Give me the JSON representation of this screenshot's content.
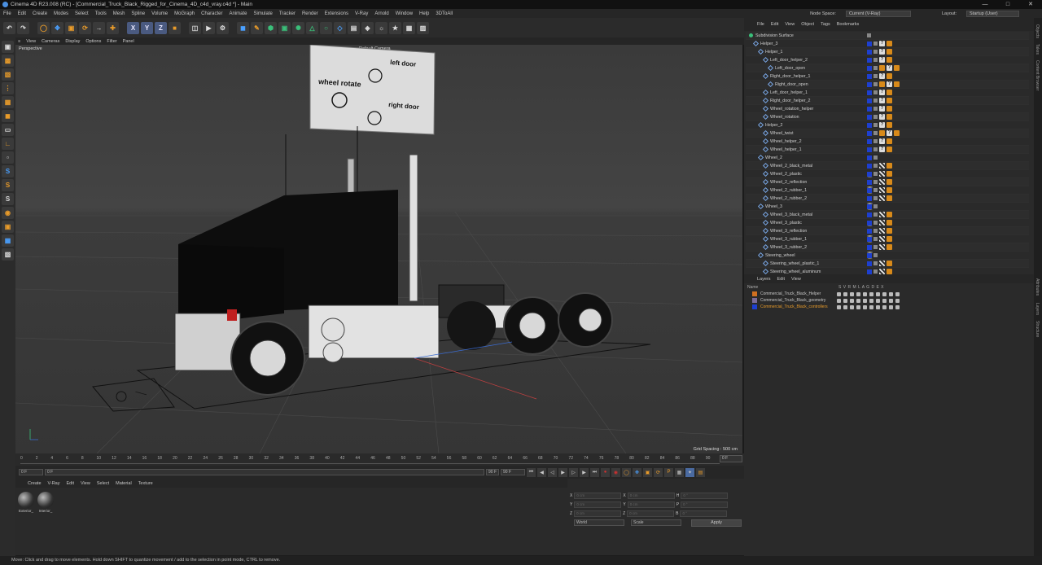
{
  "window": {
    "title": "Cinema 4D R23.008 (RC) - [Commercial_Truck_Black_Rigged_for_Cinema_4D_c4d_vray.c4d *] - Main"
  },
  "menu": [
    "File",
    "Edit",
    "Create",
    "Modes",
    "Select",
    "Tools",
    "Mesh",
    "Spline",
    "Volume",
    "MoGraph",
    "Character",
    "Animate",
    "Simulate",
    "Tracker",
    "Render",
    "Extensions",
    "V-Ray",
    "Arnold",
    "Window",
    "Help",
    "3DToAll"
  ],
  "node_space": {
    "label": "Node Space:",
    "value": "Current (V-Ray)"
  },
  "layout": {
    "label": "Layout:",
    "value": "Startup (User)"
  },
  "viewport_menu": [
    "View",
    "Cameras",
    "Display",
    "Options",
    "Filter",
    "Panel"
  ],
  "viewport": {
    "name": "Perspective",
    "camera": "Default Camera",
    "grid_spacing": "Grid Spacing : 500 cm",
    "sign_wheel_rotate": "wheel rotate",
    "sign_left_door": "left door",
    "sign_right_door": "right door"
  },
  "colors": {
    "accent": "#e89b2a",
    "blue": "#1d3fd0",
    "layer1": "#d07020",
    "layer2": "#7a6b9a",
    "layer3": "#1d3fd0"
  },
  "timeline": {
    "ticks": [
      "0",
      "2",
      "4",
      "6",
      "8",
      "10",
      "12",
      "14",
      "16",
      "18",
      "20",
      "22",
      "24",
      "26",
      "28",
      "30",
      "32",
      "34",
      "36",
      "38",
      "40",
      "42",
      "44",
      "46",
      "48",
      "50",
      "52",
      "54",
      "56",
      "58",
      "60",
      "62",
      "64",
      "66",
      "68",
      "70",
      "72",
      "74",
      "76",
      "78",
      "80",
      "82",
      "84",
      "86",
      "88",
      "90"
    ],
    "current_frame": "0 F"
  },
  "transport": {
    "start": "0 F",
    "min": "0 F",
    "max": "90 F",
    "end": "90 F"
  },
  "objects": {
    "menu": [
      "File",
      "Edit",
      "View",
      "Object",
      "Tags",
      "Bookmarks"
    ],
    "rows": [
      {
        "name": "Subdivision Surface",
        "indent": 0,
        "kind": "green",
        "tags": []
      },
      {
        "name": "Helper_3",
        "indent": 1,
        "kind": "null",
        "tags": [
          "q",
          "or"
        ]
      },
      {
        "name": "Helper_1",
        "indent": 2,
        "kind": "null",
        "tags": [
          "q",
          "or"
        ]
      },
      {
        "name": "Left_door_helper_2",
        "indent": 3,
        "kind": "null",
        "tags": [
          "q",
          "or"
        ]
      },
      {
        "name": "Left_door_open",
        "indent": 4,
        "kind": "null",
        "tags": [
          "or",
          "q",
          "or"
        ]
      },
      {
        "name": "Right_door_helper_1",
        "indent": 3,
        "kind": "null",
        "tags": [
          "q",
          "or"
        ]
      },
      {
        "name": "Right_door_open",
        "indent": 4,
        "kind": "null",
        "tags": [
          "or",
          "q",
          "or"
        ]
      },
      {
        "name": "Left_door_helper_1",
        "indent": 3,
        "kind": "null",
        "tags": [
          "q",
          "or"
        ]
      },
      {
        "name": "Right_door_helper_2",
        "indent": 3,
        "kind": "null",
        "tags": [
          "q",
          "or"
        ]
      },
      {
        "name": "Wheel_rotation_helper",
        "indent": 3,
        "kind": "null",
        "tags": [
          "q",
          "or"
        ]
      },
      {
        "name": "Wheel_rotation",
        "indent": 3,
        "kind": "null",
        "tags": [
          "q",
          "or"
        ]
      },
      {
        "name": "Helper_2",
        "indent": 2,
        "kind": "null",
        "tags": [
          "q",
          "or"
        ]
      },
      {
        "name": "Wheel_twist",
        "indent": 3,
        "kind": "null",
        "tags": [
          "or",
          "q",
          "or"
        ]
      },
      {
        "name": "Wheel_helper_2",
        "indent": 3,
        "kind": "null",
        "tags": [
          "q",
          "or"
        ]
      },
      {
        "name": "Wheel_helper_1",
        "indent": 3,
        "kind": "null",
        "tags": [
          "q",
          "or"
        ]
      },
      {
        "name": "Wheel_2",
        "indent": 2,
        "kind": "null",
        "tags": []
      },
      {
        "name": "Wheel_2_black_metal",
        "indent": 3,
        "kind": "null",
        "tags": [
          "mat",
          "ck",
          "or"
        ]
      },
      {
        "name": "Wheel_2_plastic",
        "indent": 3,
        "kind": "null",
        "tags": [
          "mat",
          "ck",
          "or"
        ]
      },
      {
        "name": "Wheel_2_reflection",
        "indent": 3,
        "kind": "null",
        "tags": [
          "mat",
          "ck",
          "or"
        ]
      },
      {
        "name": "Wheel_2_rubber_1",
        "indent": 3,
        "kind": "null",
        "tags": [
          "mat",
          "ck",
          "or"
        ]
      },
      {
        "name": "Wheel_2_rubber_2",
        "indent": 3,
        "kind": "null",
        "tags": [
          "mat",
          "ck",
          "or"
        ]
      },
      {
        "name": "Wheel_3",
        "indent": 2,
        "kind": "null",
        "tags": []
      },
      {
        "name": "Wheel_3_black_metal",
        "indent": 3,
        "kind": "null",
        "tags": [
          "mat",
          "ck",
          "or"
        ]
      },
      {
        "name": "Wheel_3_plastic",
        "indent": 3,
        "kind": "null",
        "tags": [
          "mat",
          "ck",
          "or"
        ]
      },
      {
        "name": "Wheel_3_reflection",
        "indent": 3,
        "kind": "null",
        "tags": [
          "mat",
          "ck",
          "or"
        ]
      },
      {
        "name": "Wheel_3_rubber_1",
        "indent": 3,
        "kind": "null",
        "tags": [
          "mat",
          "ck",
          "or"
        ]
      },
      {
        "name": "Wheel_3_rubber_2",
        "indent": 3,
        "kind": "null",
        "tags": [
          "mat",
          "ck",
          "or"
        ]
      },
      {
        "name": "Steering_wheel",
        "indent": 2,
        "kind": "null",
        "tags": []
      },
      {
        "name": "Steering_wheel_plastic_1",
        "indent": 3,
        "kind": "null",
        "tags": [
          "mat",
          "ck",
          "or"
        ]
      },
      {
        "name": "Steering_wheel_aluminum",
        "indent": 3,
        "kind": "null",
        "tags": [
          "mat",
          "ck",
          "or"
        ]
      }
    ]
  },
  "layers": {
    "menu": [
      "Layers",
      "Edit",
      "View"
    ],
    "header_name": "Name",
    "header_cols": "S V R M L A G D E X",
    "rows": [
      {
        "name": "Commercial_Truck_Black_Helper",
        "color": "#d07020"
      },
      {
        "name": "Commercial_Truck_Black_geometry",
        "color": "#7a6b9a"
      },
      {
        "name": "Commercial_Truck_Black_controllers",
        "color": "#1d3fd0"
      }
    ]
  },
  "materials": {
    "menu": [
      "Create",
      "V-Ray",
      "Edit",
      "View",
      "Select",
      "Material",
      "Texture"
    ],
    "items": [
      "Exterior_",
      "Interior_"
    ]
  },
  "attributes": {
    "rows": [
      [
        "X",
        "0 cm",
        "X",
        "0 cm",
        "H",
        "0 °"
      ],
      [
        "Y",
        "0 cm",
        "Y",
        "0 cm",
        "P",
        "0 °"
      ],
      [
        "Z",
        "0 cm",
        "Z",
        "0 cm",
        "B",
        "0 °"
      ]
    ],
    "world": "World",
    "scale": "Scale",
    "apply": "Apply"
  },
  "side_tabs": [
    "Objects",
    "Takes",
    "Content Browser",
    "Attributes",
    "Layers",
    "Structure"
  ],
  "status": "Move: Click and drag to move elements. Hold down SHIFT to quantize movement / add to the selection in point mode, CTRL to remove."
}
